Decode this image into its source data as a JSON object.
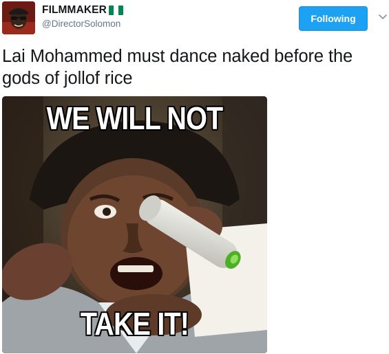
{
  "user": {
    "display_name": "FILMMAKER",
    "handle": "@DirectorSolomon",
    "badge_icon": "nigeria-flag-icon",
    "flag_colors": [
      "#008751",
      "#ffffff",
      "#008751"
    ]
  },
  "follow_button": {
    "label": "Following",
    "color": "#1da1f2"
  },
  "menu": {
    "icon": "chevron-down-icon"
  },
  "tweet": {
    "text": "Lai Mohammed must dance naked before the gods of jollof rice"
  },
  "media": {
    "caption_top": "WE WILL NOT",
    "caption_bottom": "TAKE IT!"
  }
}
